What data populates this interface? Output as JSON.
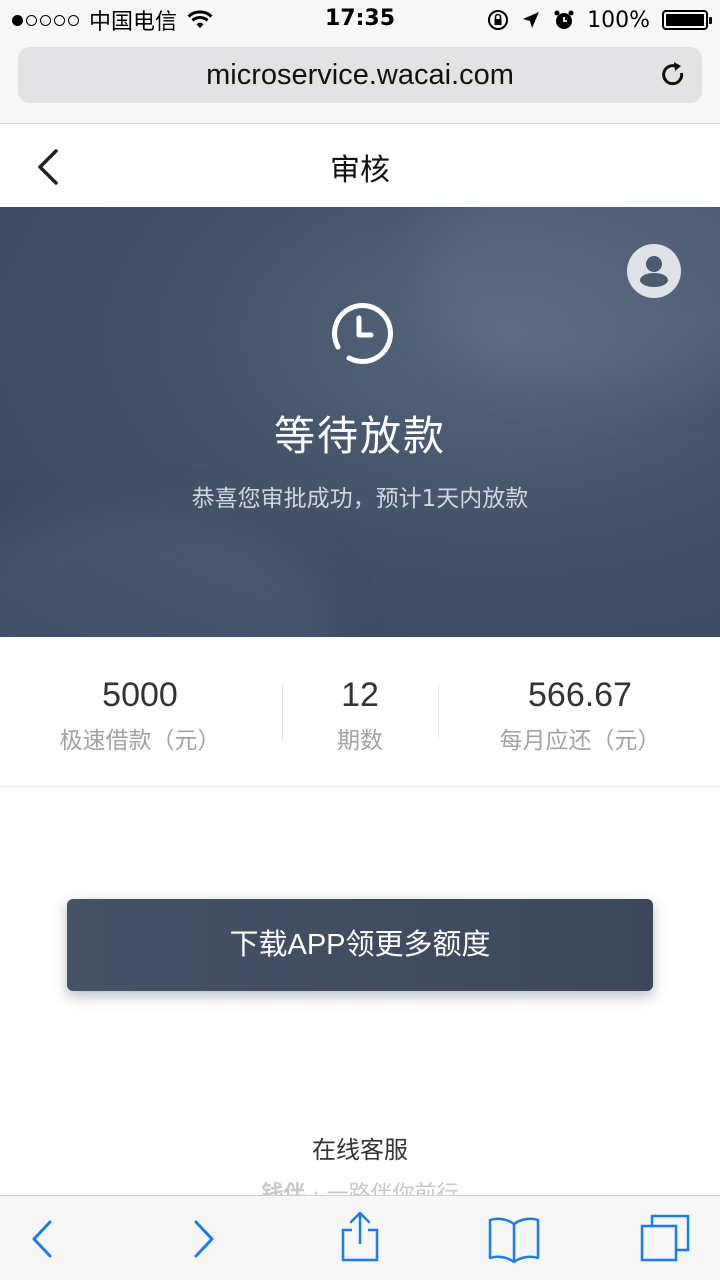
{
  "status_bar": {
    "carrier": "中国电信",
    "time": "17:35",
    "battery": "100%",
    "signal_bars_filled": 1,
    "signal_bars_total": 5,
    "battery_level": 1.0
  },
  "browser": {
    "url": "microservice.wacai.com"
  },
  "nav": {
    "title": "审核"
  },
  "hero": {
    "title": "等待放款",
    "subtitle": "恭喜您审批成功，预计1天内放款"
  },
  "stats": [
    {
      "value": "5000",
      "label": "极速借款（元）"
    },
    {
      "value": "12",
      "label": "期数"
    },
    {
      "value": "566.67",
      "label": "每月应还（元）"
    }
  ],
  "actions": {
    "download_label": "下载APP领更多额度"
  },
  "footer": {
    "service_label": "在线客服",
    "slogan_brand": "钱伴",
    "slogan_text": "· 一路伴你前行"
  },
  "colors": {
    "accent_ios_blue": "#1a7cf0",
    "hero_bg": "#46566c",
    "button_bg": "#414c61"
  }
}
